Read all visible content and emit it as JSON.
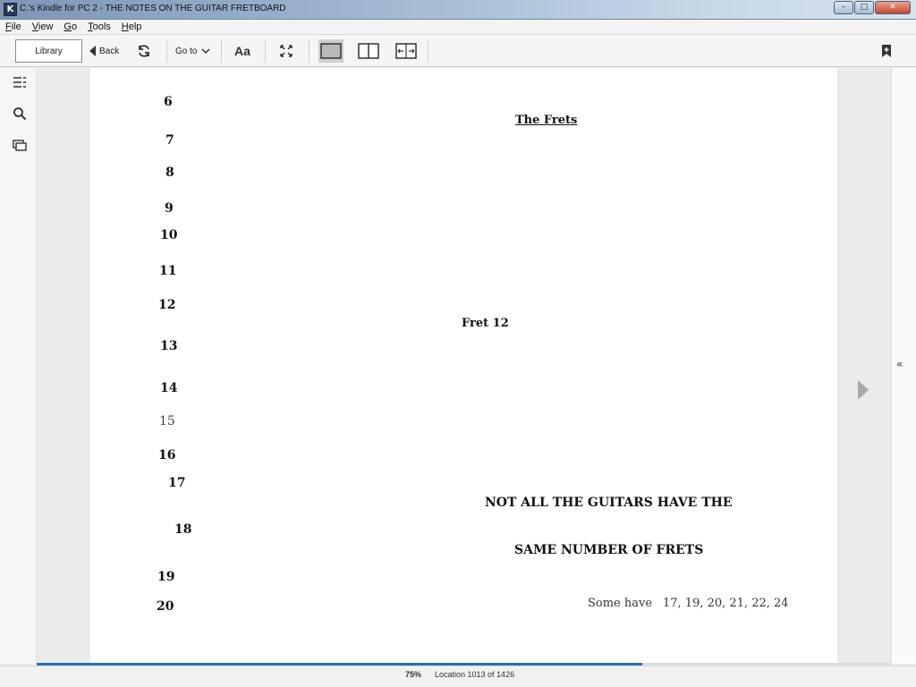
{
  "window": {
    "title": "C.'s Kindle for PC 2 - THE NOTES ON THE GUITAR FRETBOARD",
    "app_icon": "K"
  },
  "menu": [
    {
      "label": "File",
      "key": "F",
      "rest": "ile"
    },
    {
      "label": "View",
      "key": "V",
      "rest": "iew"
    },
    {
      "label": "Go",
      "key": "G",
      "rest": "o"
    },
    {
      "label": "Tools",
      "key": "T",
      "rest": "ools"
    },
    {
      "label": "Help",
      "key": "H",
      "rest": "elp"
    }
  ],
  "toolbar": {
    "library_label": "Library",
    "back_label": "Back",
    "goto_label": "Go to",
    "font_label": "Aa"
  },
  "book": {
    "fret_numbers": [
      "6",
      "7",
      "8",
      "9",
      "10",
      "11",
      "12",
      "13",
      "14",
      "15",
      "16",
      "17",
      "18",
      "19",
      "20"
    ],
    "heading": "The Frets",
    "fret_label": "Fret 12",
    "caps_line_1": "NOT ALL THE GUITARS HAVE THE",
    "caps_line_2": "SAME NUMBER OF FRETS",
    "some_have_label": "Some have",
    "some_have_values": "17, 19, 20, 21, 22, 24"
  },
  "status": {
    "percent": "75%",
    "location": "Location 1013 of 1426",
    "progress_fraction": 0.709
  },
  "colors": {
    "progress": "#2a6db5",
    "page": "#ffffff"
  }
}
